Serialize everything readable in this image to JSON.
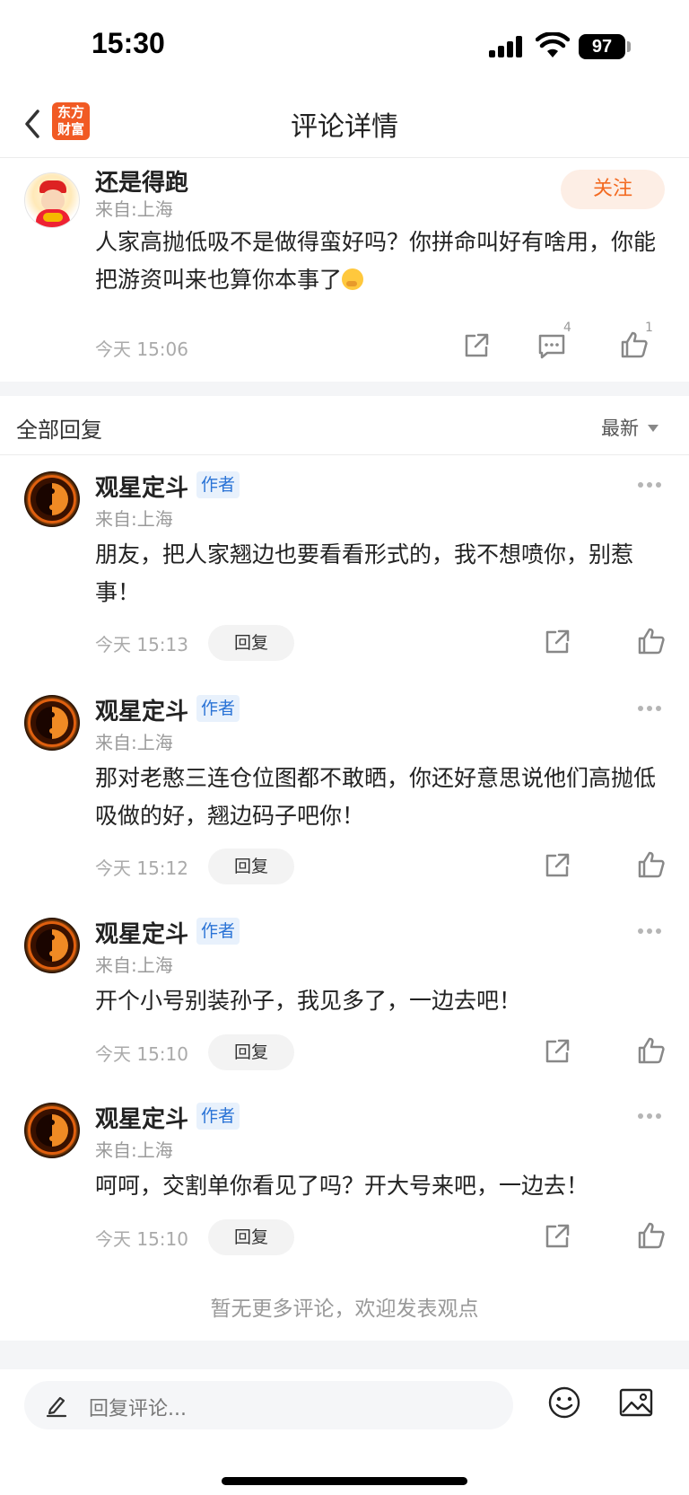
{
  "status_bar": {
    "time": "15:30",
    "battery": "97"
  },
  "nav": {
    "logo_line1": "东方",
    "logo_line2": "财富",
    "title": "评论详情"
  },
  "main_post": {
    "username": "还是得跑",
    "location": "来自:上海",
    "follow_label": "关注",
    "text": "人家高抛低吸不是做得蛮好吗？你拼命叫好有啥用，你能把游资叫来也算你本事了",
    "time": "今天 15:06",
    "comment_count": "4",
    "like_count": "1"
  },
  "replies_header": {
    "title": "全部回复",
    "sort": "最新"
  },
  "replies": [
    {
      "username": "观星定斗",
      "tag": "作者",
      "location": "来自:上海",
      "text": "朋友，把人家翘边也要看看形式的，我不想喷你，别惹事！",
      "time": "今天 15:13",
      "reply_label": "回复"
    },
    {
      "username": "观星定斗",
      "tag": "作者",
      "location": "来自:上海",
      "text": "那对老憨三连仓位图都不敢晒，你还好意思说他们高抛低吸做的好，翘边码子吧你！",
      "time": "今天 15:12",
      "reply_label": "回复"
    },
    {
      "username": "观星定斗",
      "tag": "作者",
      "location": "来自:上海",
      "text": "开个小号别装孙子，我见多了，一边去吧！",
      "time": "今天 15:10",
      "reply_label": "回复"
    },
    {
      "username": "观星定斗",
      "tag": "作者",
      "location": "来自:上海",
      "text": "呵呵，交割单你看见了吗？开大号来吧，一边去！",
      "time": "今天 15:10",
      "reply_label": "回复"
    }
  ],
  "footer_note": "暂无更多评论，欢迎发表观点",
  "bottom_bar": {
    "input_placeholder": "回复评论..."
  },
  "colors": {
    "accent": "#f36a21",
    "author_tag": "#2a73d6",
    "follow_bg": "#fdeee5"
  }
}
